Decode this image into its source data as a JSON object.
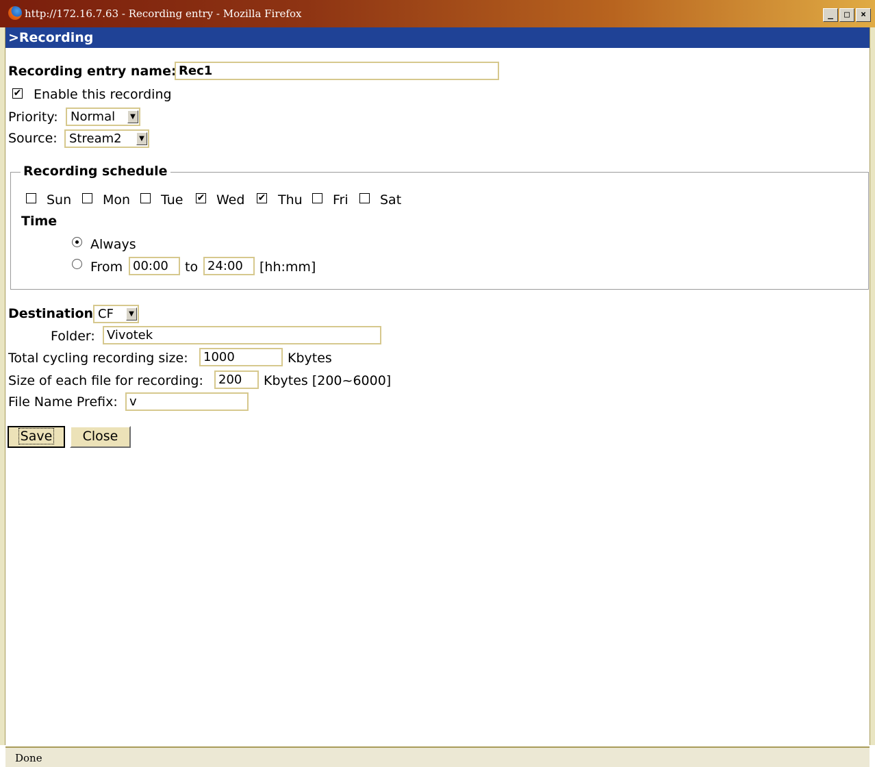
{
  "window": {
    "title": "http://172.16.7.63 - Recording entry - Mozilla Firefox",
    "min_glyph": "_",
    "max_glyph": "□",
    "close_glyph": "×"
  },
  "header": {
    "title": ">Recording"
  },
  "form": {
    "entry_name_label": "Recording entry name:",
    "entry_name_value": "Rec1",
    "enable_label": "Enable this recording",
    "enable_checked": true,
    "priority_label": "Priority:",
    "priority_value": "Normal",
    "source_label": "Source:",
    "source_value": "Stream2"
  },
  "schedule": {
    "legend": "Recording schedule",
    "days": [
      {
        "label": "Sun",
        "checked": false
      },
      {
        "label": "Mon",
        "checked": false
      },
      {
        "label": "Tue",
        "checked": false
      },
      {
        "label": "Wed",
        "checked": true
      },
      {
        "label": "Thu",
        "checked": true
      },
      {
        "label": "Fri",
        "checked": false
      },
      {
        "label": "Sat",
        "checked": false
      }
    ],
    "time_label": "Time",
    "always_label": "Always",
    "always_selected": true,
    "from_label": "From",
    "from_value": "00:00",
    "to_label": "to",
    "to_value": "24:00",
    "format_hint": "[hh:mm]"
  },
  "destination": {
    "label": "Destination",
    "value": "CF",
    "folder_label": "Folder:",
    "folder_value": "Vivotek",
    "total_size_label": "Total cycling recording size:",
    "total_size_value": "1000",
    "total_size_unit": "Kbytes",
    "file_size_label": "Size of each file for recording:",
    "file_size_value": "200",
    "file_size_unit": "Kbytes [200~6000]",
    "prefix_label": "File Name Prefix:",
    "prefix_value": "v"
  },
  "buttons": {
    "save": "Save",
    "close": "Close"
  },
  "status": {
    "text": "Done"
  },
  "icons": {
    "browser": "firefox-icon",
    "checkmark": "✔",
    "dropdown": "▼"
  }
}
